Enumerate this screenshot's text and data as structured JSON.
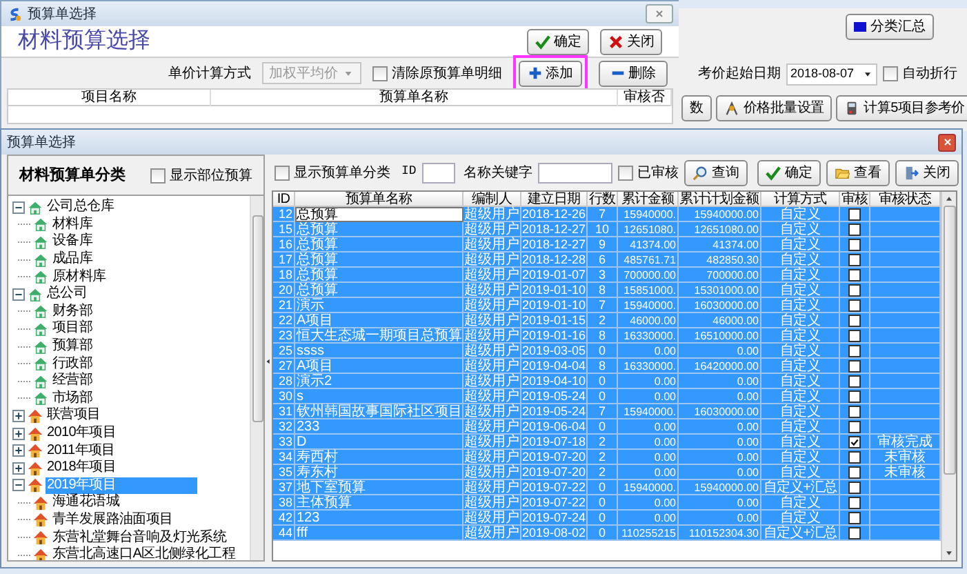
{
  "back_window": {
    "title": "预算单选择",
    "heading": "材料预算选择",
    "buttons": [
      {
        "label": "确定",
        "kind": "ok"
      },
      {
        "label": "关闭",
        "kind": "close"
      }
    ],
    "price_method": {
      "label": "单价计算方式",
      "value": "加权平均价",
      "disabled": true
    },
    "clear_detail": {
      "label": "清除原预算单明细",
      "checked": false
    },
    "add_button": {
      "label": "添加",
      "highlighted": true
    },
    "delete_button": {
      "label": "删除"
    },
    "columns": [
      "项目名称",
      "预算单名称",
      "审核否"
    ]
  },
  "main_window": {
    "summary_button": "分类汇总",
    "start_date": {
      "label": "考价起始日期",
      "value": "2018-08-07"
    },
    "auto_wrap": {
      "label": "自动折行",
      "checked": false
    },
    "cut_button": "数",
    "buttons": [
      {
        "label": "价格批量设置",
        "kind": "price"
      },
      {
        "label": "计算5项目参考价",
        "kind": "calc"
      }
    ]
  },
  "dialog": {
    "title": "预算单选择",
    "sidebar": {
      "title": "材料预算单分类",
      "show_parts": {
        "label": "显示部位预算",
        "checked": false
      },
      "tree": [
        {
          "label": "公司总仓库",
          "kind": "org",
          "expanded": true,
          "selected": false,
          "children": [
            {
              "label": "材料库",
              "kind": "org",
              "selected": false
            },
            {
              "label": "设备库",
              "kind": "org",
              "selected": false
            },
            {
              "label": "成品库",
              "kind": "org",
              "selected": false
            },
            {
              "label": "原材料库",
              "kind": "org",
              "selected": false
            }
          ]
        },
        {
          "label": "总公司",
          "kind": "org",
          "expanded": true,
          "selected": false,
          "children": [
            {
              "label": "财务部",
              "kind": "org",
              "selected": false
            },
            {
              "label": "项目部",
              "kind": "org",
              "selected": false
            },
            {
              "label": "预算部",
              "kind": "org",
              "selected": false
            },
            {
              "label": "行政部",
              "kind": "org",
              "selected": false
            },
            {
              "label": "经营部",
              "kind": "org",
              "selected": false
            },
            {
              "label": "市场部",
              "kind": "org",
              "selected": false
            }
          ]
        },
        {
          "label": "联营项目",
          "kind": "project",
          "expanded": false,
          "selected": false
        },
        {
          "label": "2010年项目",
          "kind": "project",
          "expanded": false,
          "selected": false
        },
        {
          "label": "2011年项目",
          "kind": "project",
          "expanded": false,
          "selected": false
        },
        {
          "label": "2018年项目",
          "kind": "project",
          "expanded": false,
          "selected": false
        },
        {
          "label": "2019年项目",
          "kind": "project",
          "expanded": true,
          "selected": true,
          "children": [
            {
              "label": "海通花语城",
              "kind": "project",
              "selected": false
            },
            {
              "label": "青羊发展路油面项目",
              "kind": "project",
              "selected": false
            },
            {
              "label": "东营礼堂舞台音响及灯光系统",
              "kind": "project",
              "selected": false
            },
            {
              "label": "东营北高速口A区北侧绿化工程",
              "kind": "project",
              "selected": false
            }
          ]
        }
      ]
    },
    "toolbar": {
      "show_category": {
        "label": "显示预算单分类",
        "checked": false
      },
      "id_filter": {
        "label": "ID"
      },
      "keyword": {
        "label": "名称关键字"
      },
      "reviewed": {
        "label": "已审核",
        "checked": false
      },
      "buttons": [
        {
          "label": "查询",
          "kind": "search"
        },
        {
          "label": "确定",
          "kind": "ok"
        },
        {
          "label": "查看",
          "kind": "view"
        },
        {
          "label": "关闭",
          "kind": "exit"
        }
      ]
    },
    "table": {
      "columns": [
        "ID",
        "预算单名称",
        "编制人",
        "建立日期",
        "行数",
        "累计金额",
        "累计计划金额",
        "计算方式",
        "审核",
        "审核状态"
      ],
      "rows": [
        {
          "id": "12",
          "name": "总预算",
          "author": "超级用户",
          "date": "2018-12-26",
          "lines": "7",
          "total": "15940000.",
          "plan_total": "15940000.00",
          "method": "自定义",
          "checked": false,
          "status": "",
          "selected": true,
          "editing": true
        },
        {
          "id": "15",
          "name": "总预算",
          "author": "超级用户",
          "date": "2018-12-27",
          "lines": "10",
          "total": "12651080.",
          "plan_total": "12651080.00",
          "method": "自定义",
          "checked": false,
          "status": "",
          "selected": true,
          "editing": false
        },
        {
          "id": "16",
          "name": "总预算",
          "author": "超级用户",
          "date": "2018-12-27",
          "lines": "9",
          "total": "41374.00",
          "plan_total": "41374.00",
          "method": "自定义",
          "checked": false,
          "status": "",
          "selected": true,
          "editing": false
        },
        {
          "id": "17",
          "name": "总预算",
          "author": "超级用户",
          "date": "2018-12-28",
          "lines": "6",
          "total": "485761.71",
          "plan_total": "482850.30",
          "method": "自定义",
          "checked": false,
          "status": "",
          "selected": true,
          "editing": false
        },
        {
          "id": "18",
          "name": "总预算",
          "author": "超级用户",
          "date": "2019-01-07",
          "lines": "3",
          "total": "700000.00",
          "plan_total": "700000.00",
          "method": "自定义",
          "checked": false,
          "status": "",
          "selected": true,
          "editing": false
        },
        {
          "id": "20",
          "name": "总预算",
          "author": "超级用户",
          "date": "2019-01-10",
          "lines": "8",
          "total": "15851000.",
          "plan_total": "15301000.00",
          "method": "自定义",
          "checked": false,
          "status": "",
          "selected": true,
          "editing": false
        },
        {
          "id": "21",
          "name": "演示",
          "author": "超级用户",
          "date": "2019-01-10",
          "lines": "7",
          "total": "15940000.",
          "plan_total": "16030000.00",
          "method": "自定义",
          "checked": false,
          "status": "",
          "selected": true,
          "editing": false
        },
        {
          "id": "22",
          "name": "A项目",
          "author": "超级用户",
          "date": "2019-01-15",
          "lines": "2",
          "total": "46000.00",
          "plan_total": "46000.00",
          "method": "自定义",
          "checked": false,
          "status": "",
          "selected": true,
          "editing": false
        },
        {
          "id": "23",
          "name": "恒大生态城一期项目总预算",
          "author": "超级用户",
          "date": "2019-01-16",
          "lines": "8",
          "total": "16330000.",
          "plan_total": "16510000.00",
          "method": "自定义",
          "checked": false,
          "status": "",
          "selected": true,
          "editing": false
        },
        {
          "id": "25",
          "name": "ssss",
          "author": "超级用户",
          "date": "2019-03-05",
          "lines": "0",
          "total": "0.00",
          "plan_total": "0.00",
          "method": "自定义",
          "checked": false,
          "status": "",
          "selected": true,
          "editing": false
        },
        {
          "id": "27",
          "name": "A项目",
          "author": "超级用户",
          "date": "2019-04-04",
          "lines": "8",
          "total": "16330000.",
          "plan_total": "16420000.00",
          "method": "自定义",
          "checked": false,
          "status": "",
          "selected": true,
          "editing": false
        },
        {
          "id": "28",
          "name": "演示2",
          "author": "超级用户",
          "date": "2019-04-10",
          "lines": "0",
          "total": "0.00",
          "plan_total": "0.00",
          "method": "自定义",
          "checked": false,
          "status": "",
          "selected": true,
          "editing": false
        },
        {
          "id": "30",
          "name": "s",
          "author": "超级用户",
          "date": "2019-05-24",
          "lines": "0",
          "total": "0.00",
          "plan_total": "0.00",
          "method": "自定义",
          "checked": false,
          "status": "",
          "selected": true,
          "editing": false
        },
        {
          "id": "31",
          "name": "钦州韩国故事国际社区项目",
          "author": "超级用户",
          "date": "2019-05-24",
          "lines": "7",
          "total": "15940000.",
          "plan_total": "16030000.00",
          "method": "自定义",
          "checked": false,
          "status": "",
          "selected": true,
          "editing": false
        },
        {
          "id": "32",
          "name": "233",
          "author": "超级用户",
          "date": "2019-06-04",
          "lines": "0",
          "total": "0.00",
          "plan_total": "0.00",
          "method": "自定义",
          "checked": false,
          "status": "",
          "selected": true,
          "editing": false
        },
        {
          "id": "33",
          "name": "D",
          "author": "超级用户",
          "date": "2019-07-18",
          "lines": "2",
          "total": "0.00",
          "plan_total": "0.00",
          "method": "自定义",
          "checked": true,
          "status": "审核完成",
          "selected": true,
          "editing": false
        },
        {
          "id": "34",
          "name": "寿西村",
          "author": "超级用户",
          "date": "2019-07-20",
          "lines": "2",
          "total": "0.00",
          "plan_total": "0.00",
          "method": "自定义",
          "checked": false,
          "status": "未审核",
          "selected": true,
          "editing": false
        },
        {
          "id": "35",
          "name": "寿东村",
          "author": "超级用户",
          "date": "2019-07-20",
          "lines": "2",
          "total": "0.00",
          "plan_total": "0.00",
          "method": "自定义",
          "checked": false,
          "status": "未审核",
          "selected": true,
          "editing": false
        },
        {
          "id": "37",
          "name": "地下室预算",
          "author": "超级用户",
          "date": "2019-07-22",
          "lines": "0",
          "total": "15940000.",
          "plan_total": "15940000.00",
          "method": "自定义+汇总",
          "checked": false,
          "status": "",
          "selected": true,
          "editing": false
        },
        {
          "id": "38",
          "name": "主体预算",
          "author": "超级用户",
          "date": "2019-07-22",
          "lines": "0",
          "total": "0.00",
          "plan_total": "0.00",
          "method": "自定义",
          "checked": false,
          "status": "",
          "selected": true,
          "editing": false
        },
        {
          "id": "42",
          "name": "123",
          "author": "超级用户",
          "date": "2019-07-24",
          "lines": "0",
          "total": "0.00",
          "plan_total": "0.00",
          "method": "自定义",
          "checked": false,
          "status": "",
          "selected": true,
          "editing": false
        },
        {
          "id": "44",
          "name": "fff",
          "author": "超级用户",
          "date": "2019-08-02",
          "lines": "0",
          "total": "110255215",
          "plan_total": "110152304.30",
          "method": "自定义+汇总",
          "checked": false,
          "status": "",
          "selected": true,
          "editing": false
        }
      ]
    }
  }
}
